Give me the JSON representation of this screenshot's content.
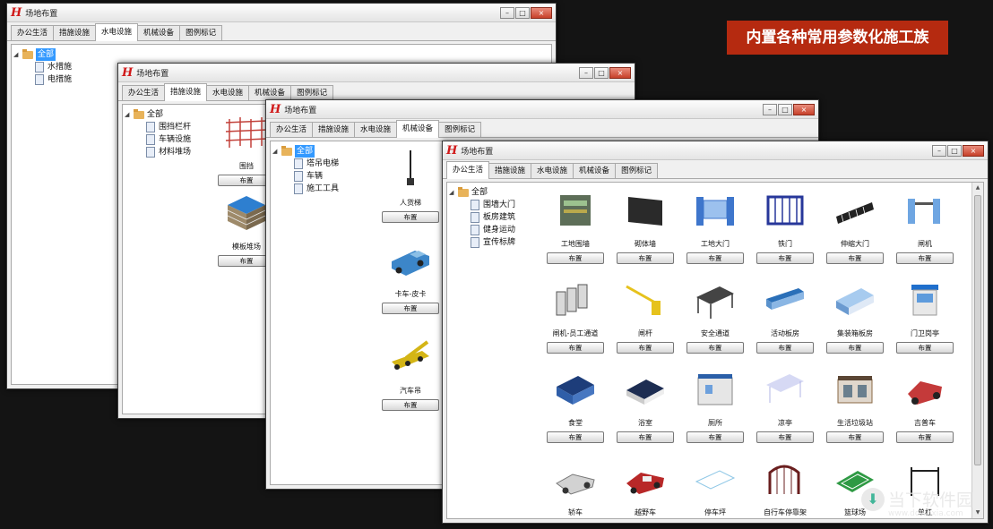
{
  "banner": "内置各种常用参数化施工族",
  "place_label": "布置",
  "window_title": "场地布置",
  "tabs": [
    "办公生活",
    "措施设施",
    "水电设施",
    "机械设备",
    "图例标记"
  ],
  "win1": {
    "tree_root": "全部",
    "tree_items": [
      "水措施",
      "电措施"
    ],
    "active_tab": 2
  },
  "win2": {
    "tree_root": "全部",
    "tree_items": [
      "围挡栏杆",
      "车辆设施",
      "材料堆场"
    ],
    "active_tab": 1,
    "items": [
      "围挡",
      "模板堆场"
    ]
  },
  "win3": {
    "tree_root": "全部",
    "tree_items": [
      "塔吊电梯",
      "车辆",
      "施工工具"
    ],
    "active_tab": 3,
    "items": [
      "人货梯",
      "卡车-皮卡",
      "汽车吊"
    ]
  },
  "win4": {
    "tree_root": "全部",
    "tree_items": [
      "围墙大门",
      "板房建筑",
      "健身运动",
      "宣传标牌"
    ],
    "active_tab": 0,
    "items": [
      "工地围墙",
      "砌体墙",
      "工地大门",
      "铁门",
      "伸缩大门",
      "闸机",
      "闸机-员工通道",
      "闸杆",
      "安全通道",
      "活动板房",
      "集装箱板房",
      "门卫岗亭",
      "食堂",
      "浴室",
      "厕所",
      "凉亭",
      "生活垃圾站",
      "吉普车",
      "轿车",
      "越野车",
      "停车坪",
      "自行车停靠架",
      "篮球场",
      "单杠"
    ]
  },
  "watermark": {
    "name": "当下软件园",
    "url": "www.downxia.com"
  },
  "colors": {
    "banner": "#b52a10",
    "selection": "#3399ff",
    "background": "#141414"
  }
}
